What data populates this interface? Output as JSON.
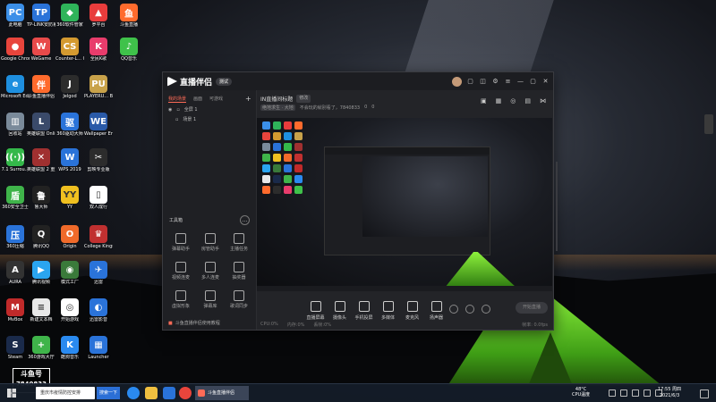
{
  "desktop_icons": [
    {
      "label": "此电脑",
      "color": "#3b8fe8",
      "glyph": "PC"
    },
    {
      "label": "TP-LINK安防系统",
      "color": "#2a73d9",
      "glyph": "TP"
    },
    {
      "label": "360软件管家",
      "color": "#2fb45a",
      "glyph": "◆"
    },
    {
      "label": "罗平台",
      "color": "#e83c3c",
      "glyph": "▲"
    },
    {
      "label": "斗鱼直播",
      "color": "#ff6b2d",
      "glyph": "鱼"
    },
    {
      "label": "Google Chrome",
      "color": "#e8453c",
      "glyph": "●"
    },
    {
      "label": "WeGame",
      "color": "#e84a4a",
      "glyph": "W"
    },
    {
      "label": "Counter-L... Global Off...",
      "color": "#d49a30",
      "glyph": "CS"
    },
    {
      "label": "全民K歌",
      "color": "#e83c6c",
      "glyph": "K"
    },
    {
      "label": "QQ音乐",
      "color": "#3fc24a",
      "glyph": "♪"
    },
    {
      "label": "Microsoft Edge",
      "color": "#1e8fdf",
      "glyph": "e"
    },
    {
      "label": "斗鱼直播伴侣",
      "color": "#ff6b2d",
      "glyph": "伴"
    },
    {
      "label": "Jelgod",
      "color": "#2c2c2c",
      "glyph": "J"
    },
    {
      "label": "PLAYERU... BATTLEG...",
      "color": "#c8a24a",
      "glyph": "PU"
    },
    {
      "label": "回收站",
      "color": "#7a8a9a",
      "glyph": "▥"
    },
    {
      "label": "英雄联盟 Online",
      "color": "#3a4a6a",
      "glyph": "L"
    },
    {
      "label": "360驱动大师",
      "color": "#2a73d9",
      "glyph": "驱"
    },
    {
      "label": "Wallpaper Engine:...",
      "color": "#2a5aa8",
      "glyph": "WE"
    },
    {
      "label": "7.1 Surrou...",
      "color": "#34b84a",
      "glyph": "((·))"
    },
    {
      "label": "英雄联盟 2 重置上线",
      "color": "#a03030",
      "glyph": "✕"
    },
    {
      "label": "WPS 2019",
      "color": "#2a73d9",
      "glyph": "W"
    },
    {
      "label": "剪映专业版",
      "color": "#2c2c2c",
      "glyph": "✂"
    },
    {
      "label": "360安全卫士",
      "color": "#3fb44a",
      "glyph": "盾"
    },
    {
      "label": "鲁大师",
      "color": "#222222",
      "glyph": "鲁"
    },
    {
      "label": "YY",
      "color": "#f0c020",
      "glyph": "YY"
    },
    {
      "label": "双人成行",
      "color": "#ffffff",
      "glyph": "▯"
    },
    {
      "label": "360压缩",
      "color": "#2a73d9",
      "glyph": "压"
    },
    {
      "label": "腾讯QQ",
      "color": "#222222",
      "glyph": "Q"
    },
    {
      "label": "Origin",
      "color": "#f06a2a",
      "glyph": "O"
    },
    {
      "label": "College Kings",
      "color": "#c03030",
      "glyph": "♛"
    },
    {
      "label": "AURA",
      "color": "#333333",
      "glyph": "A"
    },
    {
      "label": "腾讯视频",
      "color": "#2aa5f0",
      "glyph": "▶"
    },
    {
      "label": "模式工厂",
      "color": "#3a7a3a",
      "glyph": "◉"
    },
    {
      "label": "迅雷",
      "color": "#2a73d9",
      "glyph": "✈"
    },
    {
      "label": "MvBox",
      "color": "#c02a2a",
      "glyph": "M"
    },
    {
      "label": "新建文本档",
      "color": "#e8e8e8",
      "glyph": "≡"
    },
    {
      "label": "开始游戏",
      "color": "#ffffff",
      "glyph": "◎"
    },
    {
      "label": "迅雷影音",
      "color": "#2a73d9",
      "glyph": "◐"
    },
    {
      "label": "Steam",
      "color": "#1a2a4a",
      "glyph": "S"
    },
    {
      "label": "360游戏大厅",
      "color": "#3fb44a",
      "glyph": "+"
    },
    {
      "label": "酷狗音乐",
      "color": "#2a8af0",
      "glyph": "K"
    },
    {
      "label": "Launcher",
      "color": "#2a73d9",
      "glyph": "▦"
    }
  ],
  "douyu_badge": {
    "title": "斗鱼号",
    "number": "7840833"
  },
  "app": {
    "title": "直播伴侣",
    "version": "测试",
    "tabs": [
      "我的场景",
      "画面",
      "可游戏"
    ],
    "scenes": [
      {
        "label": "全屏 1"
      },
      {
        "label": "场景 1"
      }
    ],
    "tools_title": "工具箱",
    "tools": [
      {
        "label": "弹幕助手"
      },
      {
        "label": "房管助手"
      },
      {
        "label": "主播任务"
      },
      {
        "label": "视频连麦"
      },
      {
        "label": "多人连麦"
      },
      {
        "label": "抽奖器"
      },
      {
        "label": "虚拟形象"
      },
      {
        "label": "弹幕库"
      },
      {
        "label": "歌词同步"
      }
    ],
    "bottom_note": "斗鱼直播伴侣使用教程",
    "room_title": "IN直播间标题",
    "room_badge": "修改",
    "room_category": "绝地求生 · 大地",
    "room_info": "不会玩的就别看了，7840833",
    "room_viewers": "0",
    "room_likes": "0",
    "bottom_controls": [
      {
        "label": "直播屏幕"
      },
      {
        "label": "摄像头"
      },
      {
        "label": "手机投屏"
      },
      {
        "label": "多媒体"
      },
      {
        "label": "麦克风"
      },
      {
        "label": "扬声器"
      }
    ],
    "start_button": "开始直播",
    "status": [
      "CPU:0%",
      "内存:0%",
      "丢帧:0%"
    ],
    "fps": "帧率: 0.0fps",
    "bitrate": "码率: 0.0 kb/s",
    "duration": "00:00:00"
  },
  "taskbar": {
    "search_text": "重庆市疫情防控安排",
    "search_button": "搜索一下",
    "active_app": "斗鱼直播伴侣",
    "weather_temp": "48°C",
    "weather_label": "CPU温度",
    "time": "17:55 周四",
    "date": "2021/6/3"
  }
}
